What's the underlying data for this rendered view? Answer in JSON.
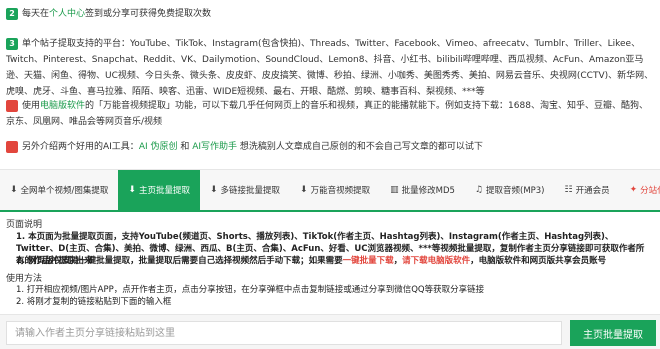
{
  "tips": [
    {
      "num": "2",
      "pre": "每天在",
      "link": "个人中心",
      "post": "签到或分享可获得免费提取次数",
      "color": "green"
    },
    {
      "num": "3",
      "text": "单个帖子提取支持的平台：YouTube、TikTok、Instagram(包含快拍)、Threads、Twitter、Facebook、Vimeo、afreecatv、Tumblr、Triller、Likee、Twitch、Pinterest、Snapchat、Reddit、VK、Dailymotion、SoundCloud、Lemon8、抖音、小红书、bilibili哔哩哔哩、西瓜视频、AcFun、Amazon亚马逊、天猫、闲鱼、得物、UC视频、今日头条、微头条、皮皮虾、皮皮搞笑、微博、秒拍、绿洲、小咖秀、美图秀秀、美拍、网易云音乐、央视网(CCTV)、新华网、虎嗅、虎牙、斗鱼、喜马拉雅、陌陌、映客、迅雷、WIDE短视频、最右、开眼、酷燃、剪映、糖事百科、梨视频、***等",
      "color": "green"
    },
    {
      "num": "4",
      "pre": "使用",
      "link": "电脑版软件",
      "post": "的「万能音视频提取」功能，可以下载几乎任何网页上的音乐和视频，真正的能播就能下。例如支持下载：1688、淘宝、知乎、豆瓣、酷狗、京东、凤凰网、唯品会等网页音乐/视频",
      "color": "red"
    },
    {
      "num": "5",
      "pre": "另外介绍两个好用的AI工具：",
      "link": "AI 伪原创",
      "mid": " 和 ",
      "link2": "AI写作助手",
      "post": " 想洗稿别人文章成自己原创的和不会自己写文章的都可以试下",
      "color": "red"
    }
  ],
  "tabs": [
    {
      "icon": "⬇",
      "label": "全网单个视频/图集提取"
    },
    {
      "icon": "⬇",
      "label": "主页批量提取"
    },
    {
      "icon": "⬇",
      "label": "多链接批量提取"
    },
    {
      "icon": "⬇",
      "label": "万能音视频提取"
    },
    {
      "icon": "▥",
      "label": "批量修改MD5"
    },
    {
      "icon": "♫",
      "label": "提取音频(MP3)"
    },
    {
      "icon": "☷",
      "label": "开通会员"
    },
    {
      "icon": "✦",
      "label": "分站代理加盟"
    }
  ],
  "description": {
    "title": "页面说明",
    "line1_bold": "1. 本页面为批量提取页面，支持YouTube(频道页、Shorts、播放列表)、TikTok(作者主页、Hashtag列表)、Instagram(作者主页、Hashtag列表)、Twitter、D(主页、合集)、美拍、微博、绿洲、西瓜、B(主页、合集)、AcFun、好看、UC浏览器视频、***等视频批量提取，复制作者主页分享链接即可获取作者所有的作品并提取出来",
    "line2_pre": "2. 网页版仅支持一键批量提取，批量提取后需要自己选择视频然后手动下载；如果需要",
    "line2_red1": "一键批量下载",
    "line2_mid": "，",
    "line2_red2": "请下载电脑版软件",
    "line2_post": "，电脑版软件和网页版共享会员账号"
  },
  "usage": {
    "title": "使用方法",
    "step1": "1. 打开相应视频/图片APP，点开作者主页，点击分享按钮，在分享弹框中点击复制链接或通过分享到微信QQ等获取分享链接",
    "step2": "2. 将刚才复制的链接粘贴到下面的输入框"
  },
  "input": {
    "placeholder": "请输入作者主页分享链接粘贴到这里"
  },
  "submit_label": "主页批量提取"
}
